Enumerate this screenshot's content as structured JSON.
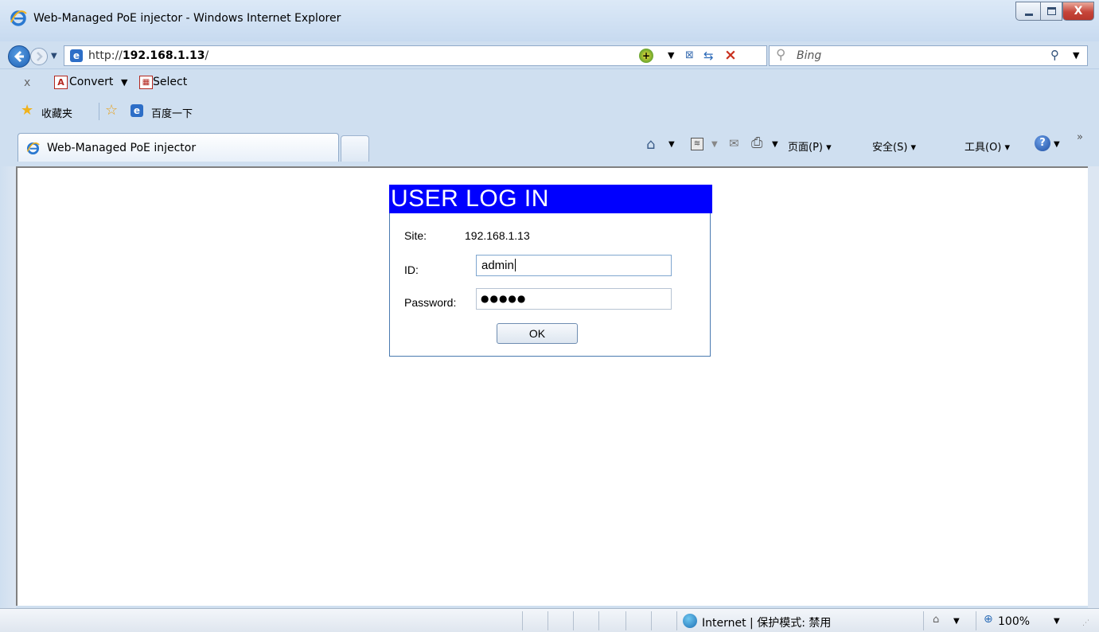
{
  "window": {
    "title": "Web-Managed PoE injector - Windows Internet Explorer",
    "close_glyph": "X"
  },
  "navigation": {
    "address_prefix": "http://",
    "address_host": "192.168.1.13",
    "address_suffix": "/",
    "search_placeholder": "Bing"
  },
  "command_bar": {
    "close_glyph": "x",
    "convert_label": "Convert",
    "select_label": "Select"
  },
  "favorites_bar": {
    "favorites_label": "收藏夹",
    "baidu_label": "百度一下"
  },
  "tabs": [
    {
      "label": "Web-Managed PoE injector"
    }
  ],
  "toolbar": {
    "page_menu": "页面(P) ▾",
    "safety_menu": "安全(S) ▾",
    "tools_menu": "工具(O) ▾",
    "more_glyph": "»"
  },
  "login": {
    "header": "USER LOG IN",
    "site_label": "Site:",
    "site_value": "192.168.1.13",
    "id_label": "ID:",
    "id_value": "admin",
    "password_label": "Password:",
    "password_mask": "●●●●●",
    "ok_label": "OK",
    "header_color": "#0000ff"
  },
  "status_bar": {
    "zone_text": "Internet | 保护模式: 禁用",
    "zoom_text": "100%"
  },
  "icons": [
    "ie-logo-icon",
    "back-icon",
    "forward-icon",
    "compat-icon",
    "refresh-icon",
    "stop-icon",
    "search-icon",
    "pdf-icon",
    "star-icon",
    "add-favorite-icon",
    "home-icon",
    "feed-icon",
    "mail-icon",
    "print-icon",
    "help-icon",
    "globe-icon",
    "zoom-icon"
  ]
}
